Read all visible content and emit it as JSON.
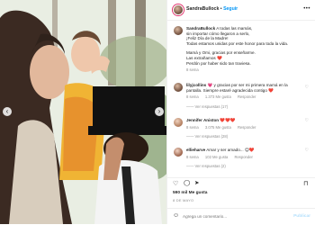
{
  "header": {
    "username": "SandraBullock",
    "separator": "•",
    "follow_label": "Seguir",
    "more_icon": "more-horizontal-icon"
  },
  "caption": {
    "username": "SandraBullock",
    "line1": "A todas las mamás,",
    "line2": "sin importar cómo llegaron a serlo,",
    "line3": "¡Feliz Día de la Madre!",
    "line4": "Todas estamos unidas por este honor para toda la vida.",
    "line5": "Mamá y Omi, gracias por enseñarme.",
    "line6": "Las extrañamos ❤️",
    "line7": "Perdón por haber sido tan traviesa.",
    "time": "8 sema"
  },
  "comments": [
    {
      "username": "lilyjcollins",
      "text": "💗 y gracias por ser mi primera mamá en la pantalla. Siempre estaré agradecida contigo ❤️",
      "time": "8 sema",
      "likes": "1.373 Me gusta",
      "reply": "Responder",
      "replies": "Ver respuestas (17)"
    },
    {
      "username": "Jennifer Aniston",
      "text": "❤️❤️❤️",
      "time": "8 sema",
      "likes": "3.075 Me gusta",
      "reply": "Responder",
      "replies": "Ver respuestas (28)"
    },
    {
      "username": "ellieharve",
      "text": "Amar y ser amado... 😊❤️",
      "time": "8 sema",
      "likes": "102 Me gusta",
      "reply": "Responder",
      "replies": "Ver respuestas (2)"
    }
  ],
  "likes_count": "590 mil Me gusta",
  "date": "8 DE MAYO",
  "add_comment": {
    "placeholder": "Agrega un comentario...",
    "post_label": "Publicar"
  },
  "colors": {
    "follow": "#0095f6",
    "post_disabled": "#b2dffc",
    "heart": "#ed4956"
  }
}
